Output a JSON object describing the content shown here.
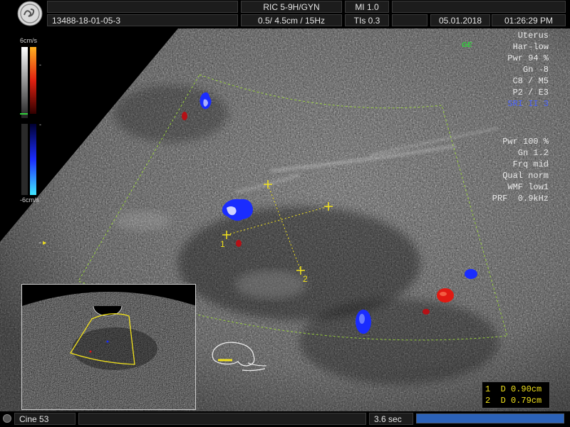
{
  "header": {
    "study_id": "13488-18-01-05-3",
    "probe": "RIC 5-9H/GYN",
    "mi": "MI  1.0",
    "depth_freq": "0.5/ 4.5cm / 15Hz",
    "tis": "TIs  0.3",
    "date": "05.01.2018",
    "time": "01:26:29 PM"
  },
  "params_2d": [
    "Uterus",
    "Har-low",
    "Pwr 94 %",
    "Gn -8",
    "C8 / M5",
    "P2 / E3",
    "SRI II 3"
  ],
  "params_color": [
    "Pwr 100 %",
    "Gn 1.2",
    "Frq mid",
    "Qual norm",
    "WMF low1",
    "PRF  0.9kHz"
  ],
  "ge_tag": "GE",
  "color_scale": {
    "top": "6cm/s",
    "bottom": "-6cm/s",
    "mid_top": "-",
    "mid_bottom": "-"
  },
  "side_marker": "-",
  "measurements": [
    {
      "label": "1  D 0.90cm"
    },
    {
      "label": "2  D 0.79cm"
    }
  ],
  "caliper_labels": [
    "1",
    "2"
  ],
  "footer": {
    "cine": "Cine 53",
    "duration": "3.6 sec",
    "cine_progress": 1.0
  },
  "colors": {
    "doppler_red": "#d8141a",
    "doppler_blue": "#1a2cff",
    "caliper": "#f2e21c",
    "roi": "#9fdc3a"
  }
}
